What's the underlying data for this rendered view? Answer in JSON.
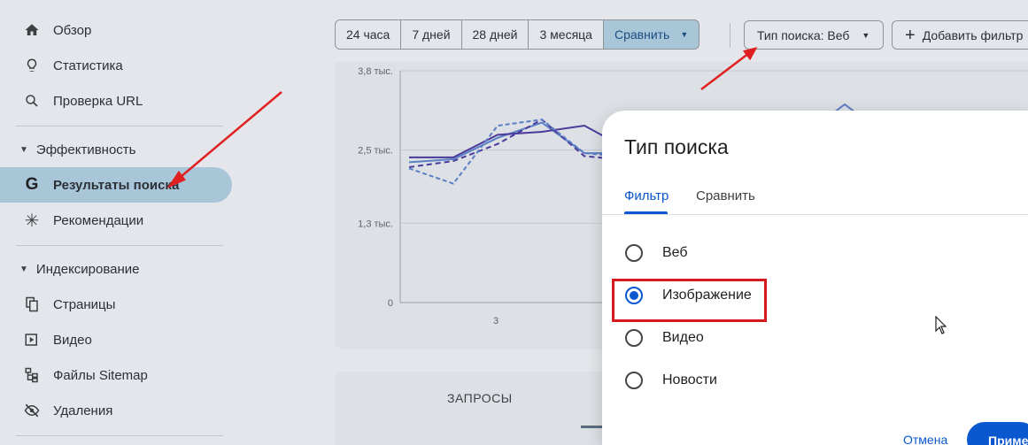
{
  "sidebar": {
    "items": [
      {
        "label": "Обзор",
        "icon": "home-icon"
      },
      {
        "label": "Статистика",
        "icon": "lightbulb-icon"
      },
      {
        "label": "Проверка URL",
        "icon": "search-icon"
      }
    ],
    "section_performance": "Эффективность",
    "performance_items": [
      {
        "label": "Результаты поиска",
        "icon": "google-icon",
        "active": true
      },
      {
        "label": "Рекомендации",
        "icon": "sparkle-icon"
      }
    ],
    "section_indexing": "Индексирование",
    "indexing_items": [
      {
        "label": "Страницы",
        "icon": "pages-icon"
      },
      {
        "label": "Видео",
        "icon": "video-icon"
      },
      {
        "label": "Файлы Sitemap",
        "icon": "sitemap-icon"
      },
      {
        "label": "Удаления",
        "icon": "eye-off-icon"
      }
    ]
  },
  "date_range": [
    "24 часа",
    "7 дней",
    "28 дней",
    "3 месяца"
  ],
  "compare_label": "Сравнить",
  "search_type_filter": "Тип поиска: Веб",
  "add_filter_label": "Добавить фильтр",
  "table": {
    "tab_queries": "ЗАПРОСЫ"
  },
  "modal": {
    "title": "Тип поиска",
    "tabs": [
      "Фильтр",
      "Сравнить"
    ],
    "active_tab": "Фильтр",
    "options": [
      "Веб",
      "Изображение",
      "Видео",
      "Новости"
    ],
    "selected": "Изображение",
    "cancel_label": "Отмена",
    "apply_label": "Приме"
  },
  "colors": {
    "accent": "#0b57d0",
    "highlight": "#d41a1f",
    "annotation_arrow": "#e02020"
  },
  "chart_data": {
    "type": "line",
    "yticks": [
      "3,8 тыс.",
      "2,5 тыс.",
      "1,3 тыс.",
      "0"
    ],
    "xticks": [
      "3"
    ],
    "ylim": [
      0,
      3800
    ],
    "x": [
      1,
      2,
      3,
      4,
      5,
      6
    ],
    "series": [
      {
        "values": [
          2300,
          2350,
          2700,
          2950,
          2450,
          2450
        ]
      },
      {
        "values": [
          2380,
          2380,
          2750,
          2800,
          2900,
          2600
        ]
      },
      {
        "values": [
          2220,
          2320,
          2600,
          3000,
          2400,
          2350
        ]
      },
      {
        "values": [
          2200,
          1950,
          2900,
          3000,
          2450,
          2400
        ]
      }
    ]
  }
}
